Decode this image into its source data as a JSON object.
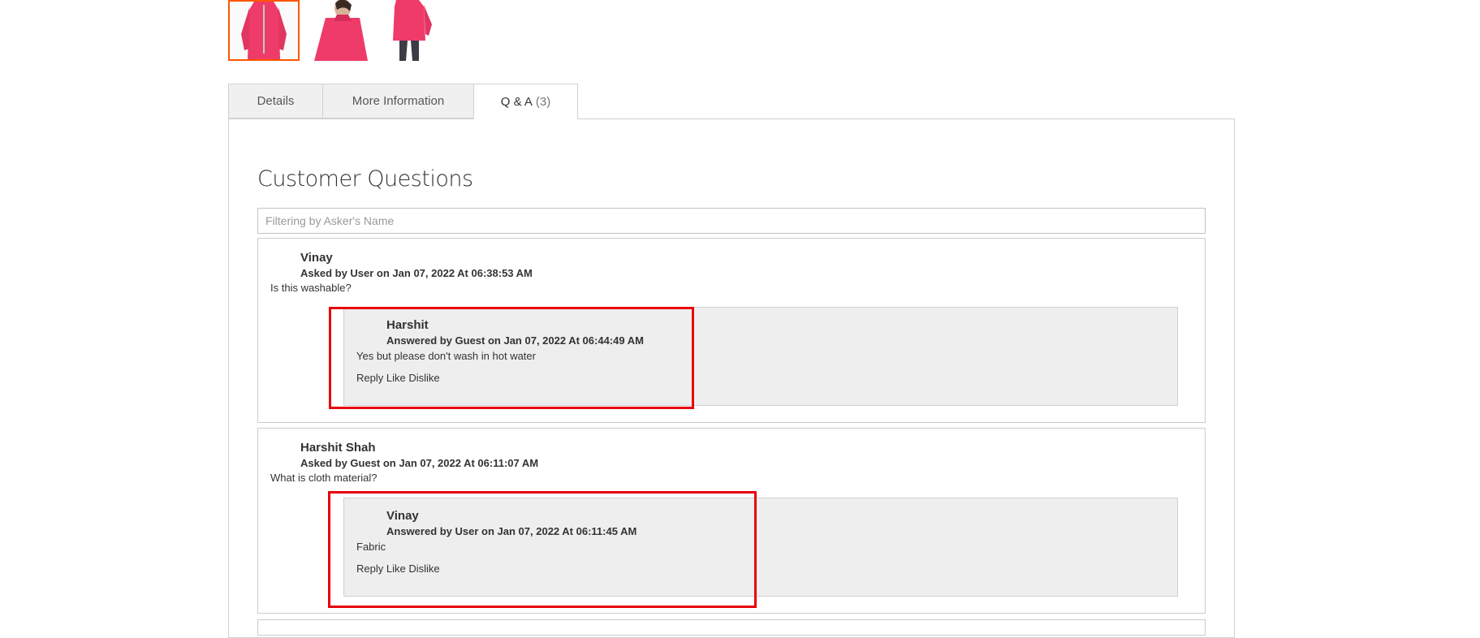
{
  "tabs": [
    {
      "label": "Details"
    },
    {
      "label": "More Information"
    },
    {
      "label": "Q & A",
      "count": "(3)"
    }
  ],
  "section_title": "Customer Questions",
  "filter": {
    "placeholder": "Filtering by Asker's Name",
    "value": ""
  },
  "questions": [
    {
      "name": "Vinay",
      "meta": "Asked by User on Jan 07, 2022 At 06:38:53 AM",
      "text": "Is this washable?",
      "answer": {
        "name": "Harshit",
        "meta": "Answered by Guest on Jan 07, 2022 At 06:44:49 AM",
        "text": "Yes but please don't wash in hot water",
        "actions": [
          "Reply",
          "Like",
          "Dislike"
        ]
      }
    },
    {
      "name": "Harshit Shah",
      "meta": "Asked by Guest on Jan 07, 2022 At 06:11:07 AM",
      "text": "What is cloth material?",
      "answer": {
        "name": "Vinay",
        "meta": "Answered by User on Jan 07, 2022 At 06:11:45 AM",
        "text": "Fabric",
        "actions": [
          "Reply",
          "Like",
          "Dislike"
        ]
      }
    }
  ],
  "colors": {
    "product": "#ee3b6a",
    "active_thumb_border": "#ff5501",
    "highlight": "#e8000b"
  }
}
